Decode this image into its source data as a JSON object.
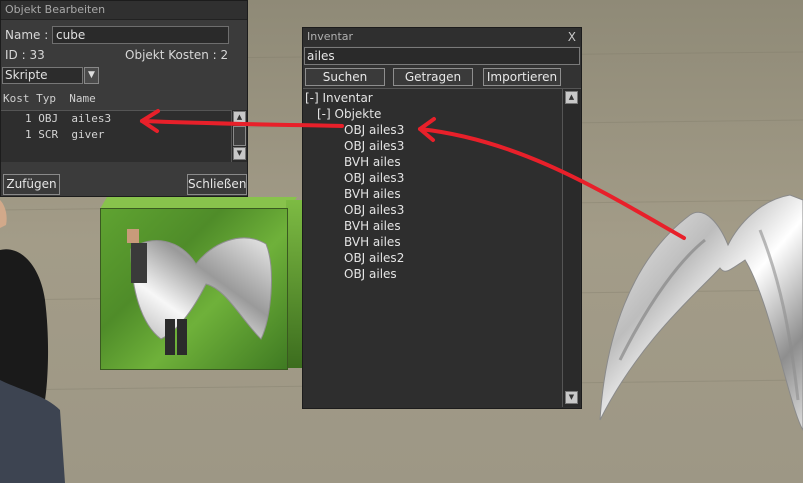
{
  "edit_panel": {
    "title": "Objekt Bearbeiten",
    "name_label": "Name :",
    "name_value": "cube",
    "id_label": "ID : 33",
    "cost_label": "Objekt Kosten : 2",
    "dropdown_value": "Skripte",
    "columns": "Kost Typ  Name",
    "scripts": [
      {
        "text": "1 OBJ  ailes3"
      },
      {
        "text": "1 SCR  giver"
      }
    ],
    "add_button": "Zufügen",
    "close_button": "Schließen"
  },
  "inventory_panel": {
    "title": "Inventar",
    "close_glyph": "X",
    "search_value": "ailes",
    "search_button": "Suchen",
    "worn_button": "Getragen",
    "import_button": "Importieren",
    "root_label": "[-] Inventar",
    "folder_label": "[-] Objekte",
    "items": [
      "OBJ ailes3",
      "OBJ ailes3",
      "BVH ailes",
      "OBJ ailes3",
      "BVH ailes",
      "OBJ ailes3",
      "BVH ailes",
      "BVH ailes",
      "OBJ ailes2",
      "OBJ ailes"
    ]
  },
  "colors": {
    "arrow": "#e8202a",
    "panel_bg": "#333333"
  }
}
